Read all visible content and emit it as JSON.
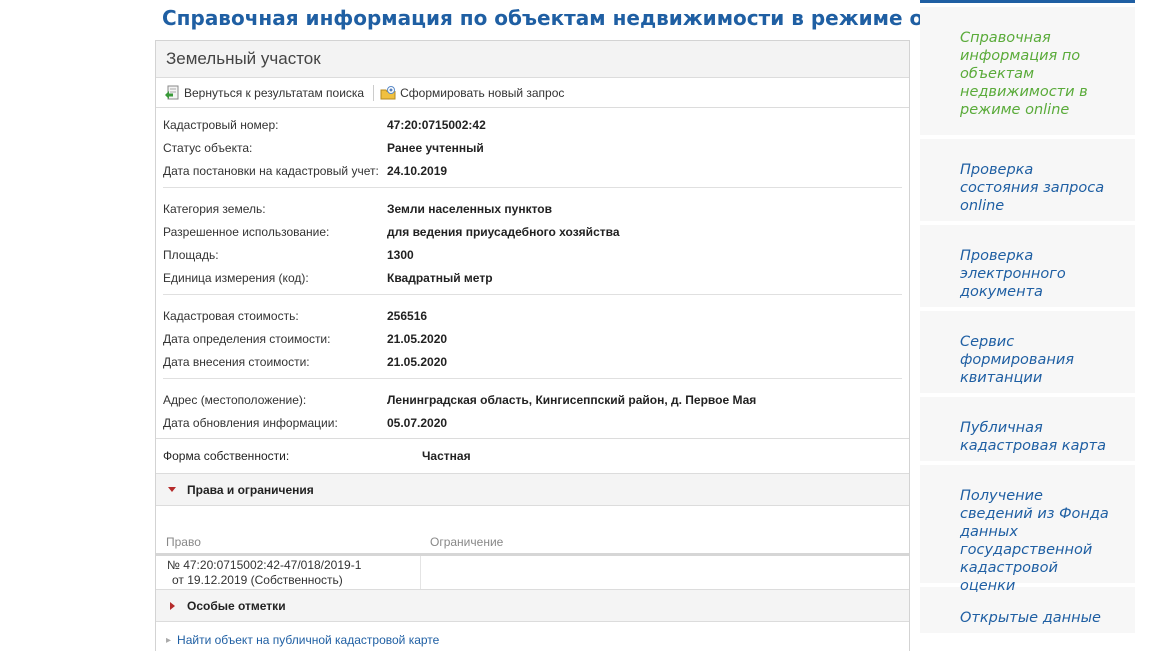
{
  "page_title": "Справочная информация по объектам недвижимости в режиме online",
  "card_title": "Земельный участок",
  "toolbar": {
    "back_label": "Вернуться к результатам поиска",
    "new_request_label": "Сформировать новый запрос"
  },
  "groups": [
    [
      {
        "label": "Кадастровый номер:",
        "value": "47:20:0715002:42"
      },
      {
        "label": "Статус объекта:",
        "value": "Ранее учтенный"
      },
      {
        "label": "Дата постановки на кадастровый учет:",
        "value": "24.10.2019"
      }
    ],
    [
      {
        "label": "Категория земель:",
        "value": "Земли населенных пунктов"
      },
      {
        "label": "Разрешенное использование:",
        "value": "для ведения приусадебного хозяйства"
      },
      {
        "label": "Площадь:",
        "value": "1300"
      },
      {
        "label": "Единица измерения (код):",
        "value": "Квадратный метр"
      }
    ],
    [
      {
        "label": "Кадастровая стоимость:",
        "value": "256516"
      },
      {
        "label": "Дата определения стоимости:",
        "value": "21.05.2020"
      },
      {
        "label": "Дата внесения стоимости:",
        "value": "21.05.2020"
      }
    ],
    [
      {
        "label": "Адрес (местоположение):",
        "value": "Ленинградская область, Кингисеппский район, д. Первое Мая"
      },
      {
        "label": "Дата обновления информации:",
        "value": "05.07.2020"
      }
    ]
  ],
  "ownership": {
    "label": "Форма собственности:",
    "value": "Частная"
  },
  "rights_section": {
    "title": "Права и ограничения",
    "col_right": "Право",
    "col_restriction": "Ограничение",
    "row_line1": "№ 47:20:0715002:42-47/018/2019-1",
    "row_line2": "от 19.12.2019  (Собственность)"
  },
  "special_section": {
    "title": "Особые отметки"
  },
  "map_link": "Найти объект на публичной кадастровой карте",
  "sidebar": [
    {
      "label": "Справочная информация по объектам недвижимости в режиме online",
      "active": true
    },
    {
      "label": "Проверка состояния запроса online"
    },
    {
      "label": "Проверка электронного документа"
    },
    {
      "label": "Сервис формирования квитанции"
    },
    {
      "label": "Публичная кадастровая карта"
    },
    {
      "label": "Получение сведений из Фонда данных государственной кадастровой оценки"
    },
    {
      "label": "Открытые данные"
    }
  ],
  "colors": {
    "accent": "#1f5fa3",
    "active": "#5aab3a",
    "triangle": "#b52b2b"
  }
}
